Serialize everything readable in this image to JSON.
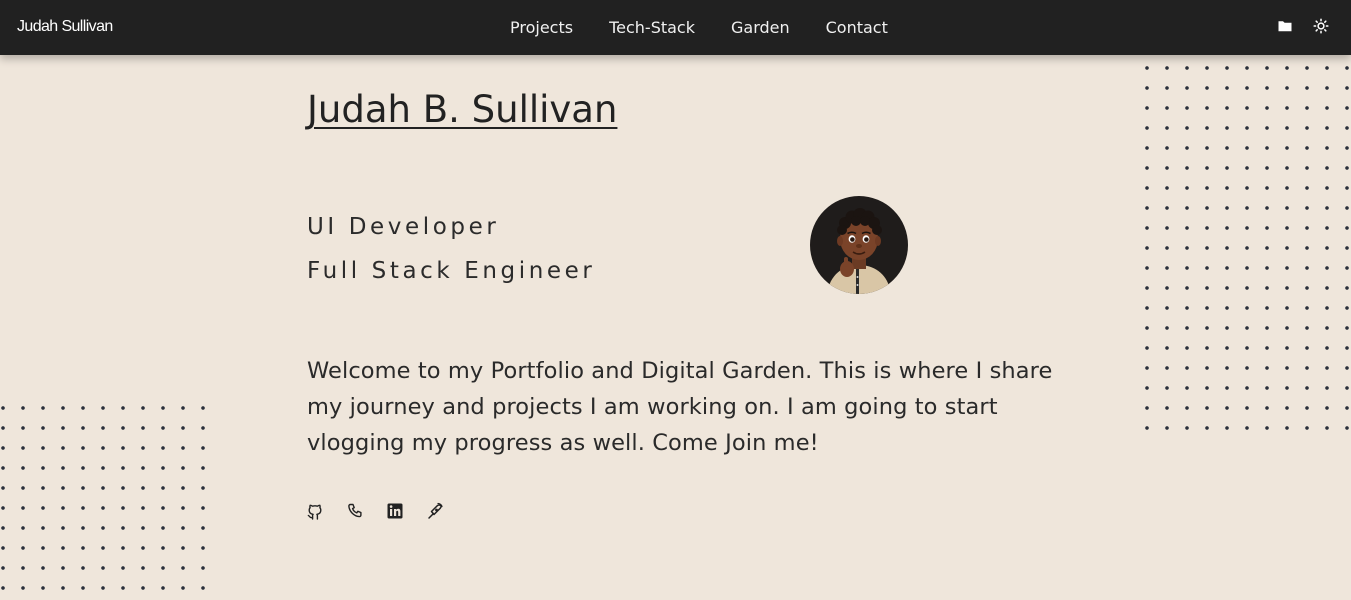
{
  "nav": {
    "brand": "Judah Sullivan",
    "links": [
      "Projects",
      "Tech-Stack",
      "Garden",
      "Contact"
    ],
    "icons": [
      "folder-icon",
      "sun-icon"
    ]
  },
  "hero": {
    "name": "Judah B. Sullivan",
    "roles": [
      "UI Developer",
      "Full Stack Engineer"
    ],
    "intro": "Welcome to my Portfolio and Digital Garden. This is where I share my journey and projects I am working on. I am going to start vlogging my progress as well. Come Join me!"
  },
  "socials": [
    "github-icon",
    "phone-icon",
    "linkedin-icon",
    "hashnode-icon"
  ],
  "colors": {
    "background": "#efe6db",
    "navbar": "#212121",
    "text": "#222222",
    "dots": "#2a2f3a"
  }
}
